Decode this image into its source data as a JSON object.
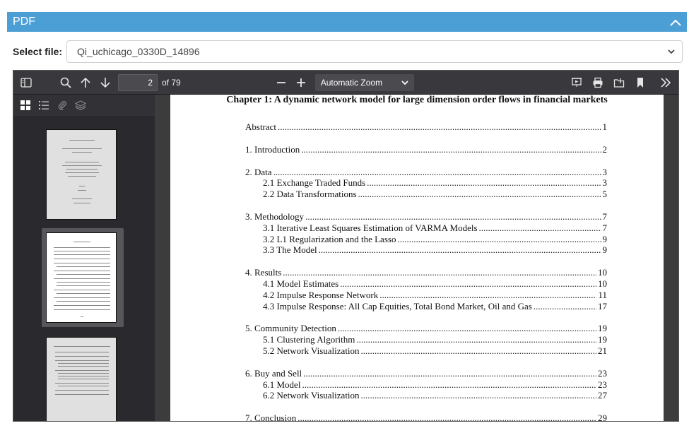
{
  "panel": {
    "title": "PDF"
  },
  "file_select": {
    "label": "Select file:",
    "value": "Qi_uchicago_0330D_14896"
  },
  "toolbar": {
    "page_number": "2",
    "page_count": "of 79",
    "zoom": "Automatic Zoom",
    "icons": [
      "sidebar-toggle-icon",
      "search-icon",
      "arrow-up-icon",
      "arrow-down-icon",
      "minus-icon",
      "plus-icon",
      "presentation-icon",
      "print-icon",
      "open-file-icon",
      "bookmark-icon",
      "double-chevron-right-icon"
    ]
  },
  "sidebar": {
    "tabs": [
      "thumbnails",
      "outline",
      "attachments",
      "layers"
    ]
  },
  "document": {
    "chapter_title": "Chapter 1: A dynamic network model for large dimension order flows in financial markets",
    "toc": [
      {
        "title": "Abstract",
        "page": "1",
        "level": 0
      },
      {
        "gap": true
      },
      {
        "title": "1. Introduction",
        "page": "2",
        "level": 0
      },
      {
        "gap": true
      },
      {
        "title": "2. Data",
        "page": "3",
        "level": 0
      },
      {
        "title": "2.1 Exchange Traded Funds",
        "page": "3",
        "level": 1
      },
      {
        "title": "2.2 Data Transformations",
        "page": "5",
        "level": 1
      },
      {
        "gap": true
      },
      {
        "title": "3. Methodology",
        "page": "7",
        "level": 0
      },
      {
        "title": "3.1 Iterative Least Squares Estimation of VARMA Models",
        "page": "7",
        "level": 1
      },
      {
        "title": "3.2 L1 Regularization and the Lasso",
        "page": "9",
        "level": 1
      },
      {
        "title": "3.3 The Model",
        "page": "9",
        "level": 1
      },
      {
        "gap": true
      },
      {
        "title": "4. Results",
        "page": "10",
        "level": 0
      },
      {
        "title": "4.1 Model Estimates",
        "page": "10",
        "level": 1
      },
      {
        "title": "4.2 Impulse Response Network",
        "page": "11",
        "level": 1
      },
      {
        "title": "4.3 Impulse Response: All Cap Equities, Total Bond Market, Oil and Gas",
        "page": "17",
        "level": 1
      },
      {
        "gap": true
      },
      {
        "title": "5. Community Detection",
        "page": "19",
        "level": 0
      },
      {
        "title": "5.1 Clustering Algorithm",
        "page": "19",
        "level": 1
      },
      {
        "title": "5.2 Network Visualization",
        "page": "21",
        "level": 1
      },
      {
        "gap": true
      },
      {
        "title": "6. Buy and Sell",
        "page": "23",
        "level": 0
      },
      {
        "title": "6.1 Model",
        "page": "23",
        "level": 1
      },
      {
        "title": "6.2 Network Visualization",
        "page": "27",
        "level": 1
      },
      {
        "gap": true
      },
      {
        "title": "7. Conclusion",
        "page": "29",
        "level": 0
      }
    ]
  }
}
